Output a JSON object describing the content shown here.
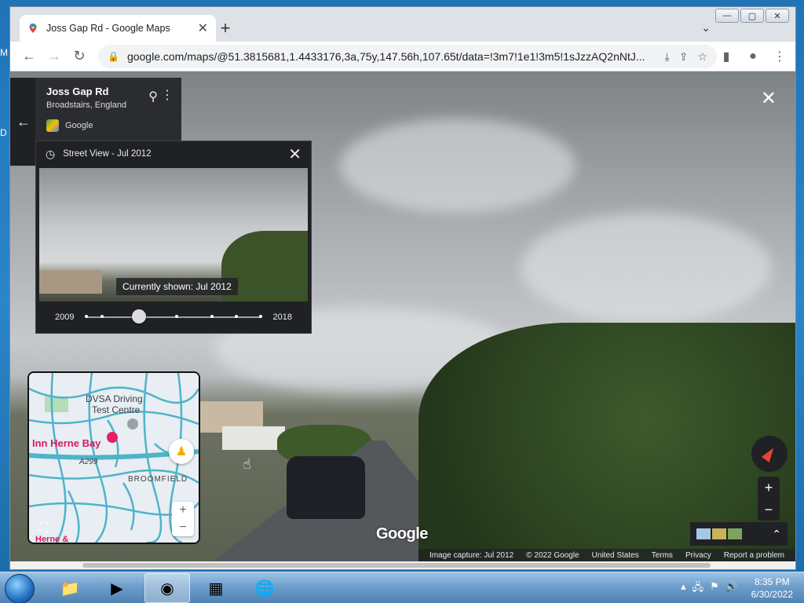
{
  "desktop": {
    "frag1": "M",
    "frag2": "D"
  },
  "browser": {
    "tab_title": "Joss Gap Rd - Google Maps",
    "new_tab": "+",
    "tab_close": "✕",
    "url": "google.com/maps/@51.3815681,1.4433176,3a,75y,147.56h,107.65t/data=!3m7!1e1!3m5!1sJzzAQ2nNtJ...",
    "win_min": "—",
    "win_max": "▢",
    "win_close": "✕"
  },
  "place": {
    "name": "Joss Gap Rd",
    "subtitle": "Broadstairs, England",
    "source": "Google"
  },
  "time_machine": {
    "header": "Street View - Jul 2012",
    "caption": "Currently shown: Jul 2012",
    "start_year": "2009",
    "end_year": "2018",
    "selected_fraction": 0.3,
    "dot_fractions": [
      0.0,
      0.09,
      0.3,
      0.52,
      0.72,
      0.86,
      1.0
    ]
  },
  "minimap": {
    "poi1": "DVSA Driving",
    "poi1b": "Test Centre",
    "poi2": "Inn Herne Bay",
    "road": "A299",
    "area": "BROOMFIELD",
    "poi3": "Herne &"
  },
  "watermark": "Google",
  "footer": {
    "capture": "Image capture: Jul 2012",
    "copyright": "© 2022 Google",
    "country": "United States",
    "terms": "Terms",
    "privacy": "Privacy",
    "report": "Report a problem"
  },
  "taskbar": {
    "time": "8:35 PM",
    "date": "6/30/2022"
  }
}
